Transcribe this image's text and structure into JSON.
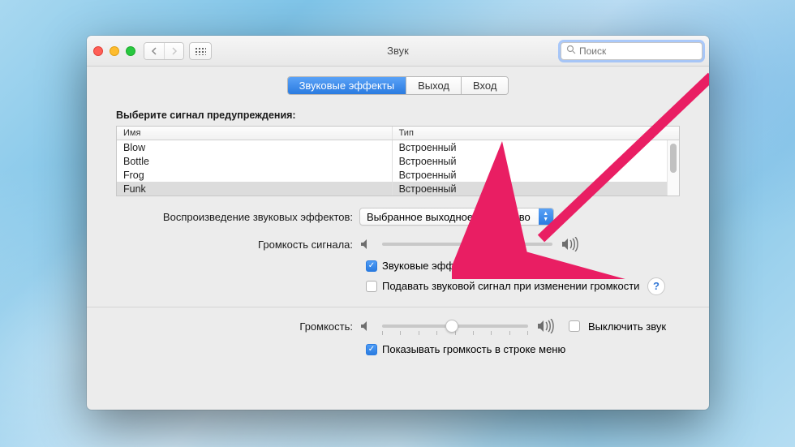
{
  "window": {
    "title": "Звук",
    "search_placeholder": "Поиск"
  },
  "tabs": {
    "effects": "Звуковые эффекты",
    "output": "Выход",
    "input": "Вход"
  },
  "alert_section": {
    "heading": "Выберите сигнал предупреждения:",
    "col_name": "Имя",
    "col_type": "Тип",
    "rows": [
      {
        "name": "Blow",
        "type": "Встроенный"
      },
      {
        "name": "Bottle",
        "type": "Встроенный"
      },
      {
        "name": "Frog",
        "type": "Встроенный"
      },
      {
        "name": "Funk",
        "type": "Встроенный"
      }
    ]
  },
  "effects_device": {
    "label": "Воспроизведение звуковых эффектов:",
    "value": "Выбранное выходное устройство"
  },
  "alert_volume": {
    "label": "Громкость сигнала:"
  },
  "checkboxes": {
    "ui_sounds": "Звуковые эффекты интерфейса",
    "feedback_volume": "Подавать звуковой сигнал при изменении громкости",
    "mute": "Выключить звук",
    "show_menu": "Показывать громкость в строке меню"
  },
  "output_volume": {
    "label": "Громкость:"
  },
  "help": "?"
}
